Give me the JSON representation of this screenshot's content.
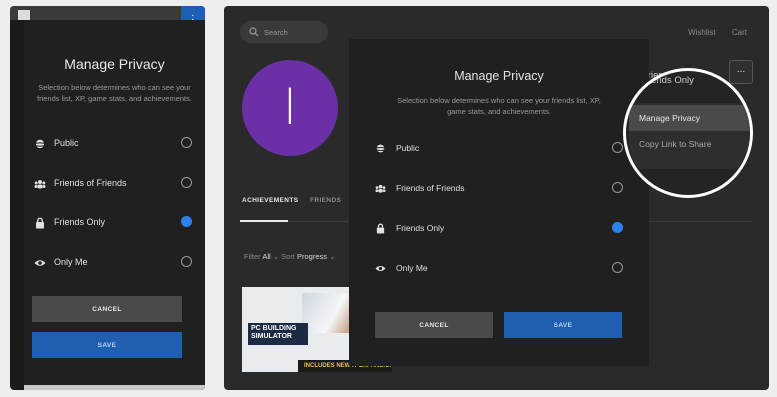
{
  "search": {
    "placeholder": "Search"
  },
  "topnav": {
    "wishlist": "Wishlist",
    "cart": "Cart"
  },
  "profile": {
    "avatar_initial": "l"
  },
  "tabs": [
    "ACHIEVEMENTS",
    "FRIENDS"
  ],
  "filters": {
    "filter_label": "Filter",
    "filter_value": "All",
    "sort_label": "Sort",
    "sort_value": "Progress"
  },
  "game_card": {
    "logo_text": "PC BUILDING SIMULATOR",
    "banner": "INCLUDES NEW IT EXPANSION"
  },
  "privacy_badge": "Friends Only",
  "more_button": "...",
  "dropdown": {
    "items": [
      "Manage Privacy",
      "Copy Link to Share"
    ]
  },
  "modal": {
    "title": "Manage Privacy",
    "description": "Selection below determines who can see your friends list, XP, game stats, and achievements.",
    "options": [
      {
        "label": "Public",
        "icon": "globe-icon",
        "selected": false
      },
      {
        "label": "Friends of Friends",
        "icon": "group-icon",
        "selected": false
      },
      {
        "label": "Friends Only",
        "icon": "lock-icon",
        "selected": true
      },
      {
        "label": "Only Me",
        "icon": "eye-icon",
        "selected": false
      }
    ],
    "cancel_label": "CANCEL",
    "save_label": "SAVE"
  },
  "colors": {
    "accent": "#2f80ed",
    "save": "#1f5fb0",
    "avatar": "#6b2fa6"
  }
}
